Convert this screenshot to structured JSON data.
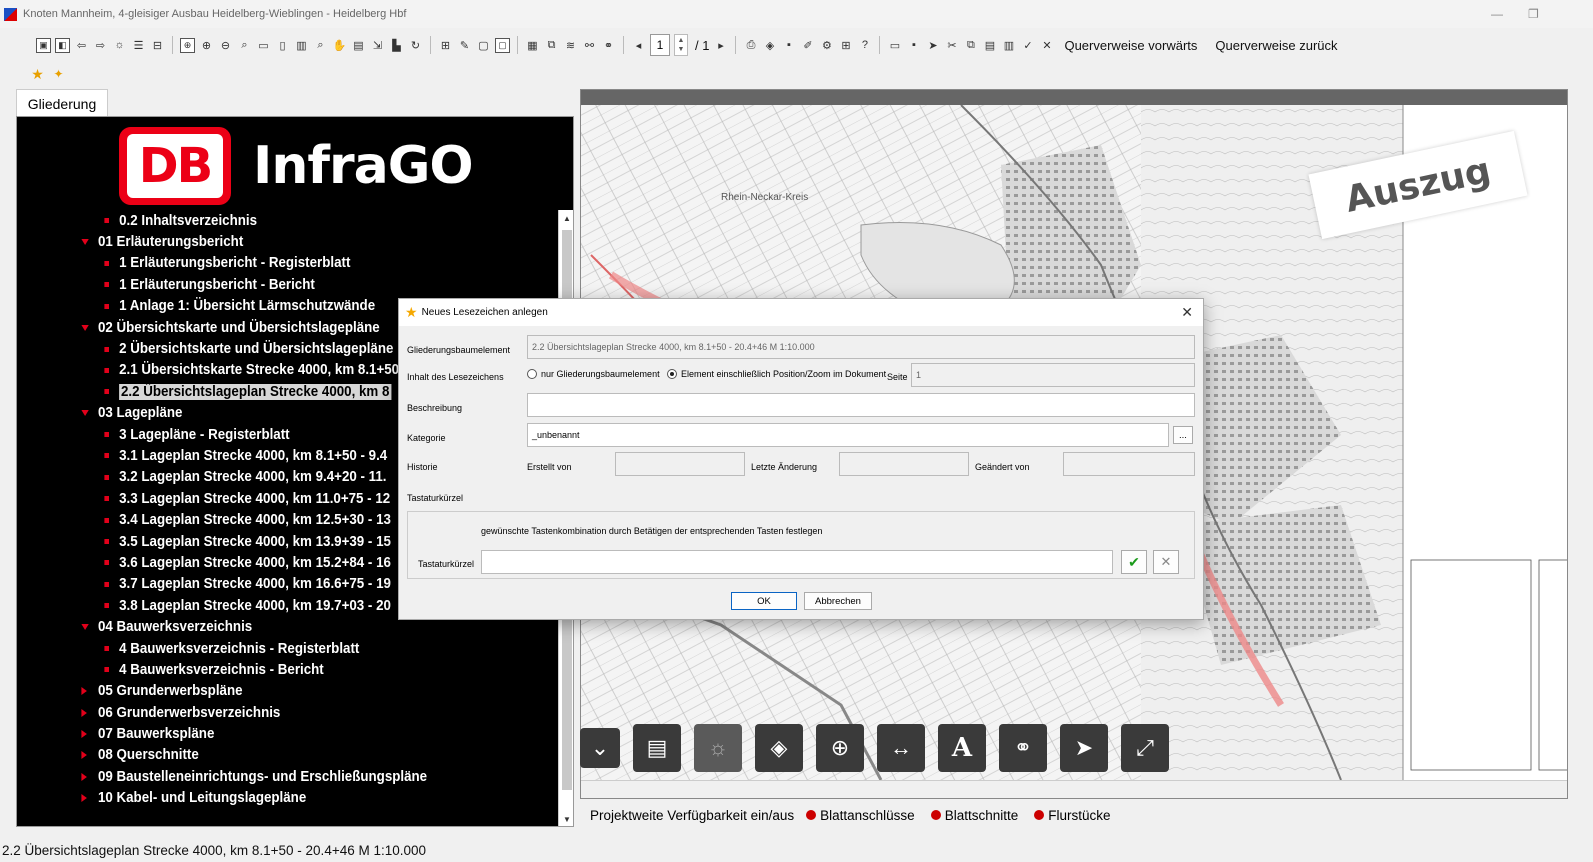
{
  "window": {
    "title": "Knoten Mannheim, 4-gleisiger Ausbau Heidelberg-Wieblingen - Heidelberg Hbf"
  },
  "toolbar": {
    "page_current": "1",
    "page_total": "/ 1",
    "cross_ref_forward": "Querverweise vorwärts",
    "cross_ref_back": "Querverweise zurück"
  },
  "left_panel": {
    "tab_label": "Gliederung",
    "logo_db": "DB",
    "logo_text": "InfraGO"
  },
  "tree": [
    {
      "label": "0.2 Inhaltsverzeichnis",
      "level": 1,
      "type": "leaf"
    },
    {
      "label": "01 Erläuterungsbericht",
      "level": 0,
      "type": "open"
    },
    {
      "label": "1 Erläuterungsbericht - Registerblatt",
      "level": 1,
      "type": "leaf"
    },
    {
      "label": "1 Erläuterungsbericht - Bericht",
      "level": 1,
      "type": "leaf"
    },
    {
      "label": "1 Anlage 1: Übersicht Lärmschutzwände",
      "level": 1,
      "type": "leaf"
    },
    {
      "label": "02 Übersichtskarte und Übersichtslagepläne",
      "level": 0,
      "type": "open"
    },
    {
      "label": "2 Übersichtskarte und Übersichtslagepläne",
      "level": 1,
      "type": "leaf"
    },
    {
      "label": "2.1 Übersichtskarte Strecke 4000, km 8.1+50",
      "level": 1,
      "type": "leaf"
    },
    {
      "label": "2.2 Übersichtslageplan Strecke 4000, km 8",
      "level": 1,
      "type": "leaf",
      "selected": true
    },
    {
      "label": "03 Lagepläne",
      "level": 0,
      "type": "open"
    },
    {
      "label": "3 Lagepläne - Registerblatt",
      "level": 1,
      "type": "leaf"
    },
    {
      "label": "3.1 Lageplan Strecke 4000, km 8.1+50 - 9.4",
      "level": 1,
      "type": "leaf"
    },
    {
      "label": "3.2 Lageplan Strecke 4000, km 9.4+20 - 11.",
      "level": 1,
      "type": "leaf"
    },
    {
      "label": "3.3 Lageplan Strecke 4000, km 11.0+75 - 12",
      "level": 1,
      "type": "leaf"
    },
    {
      "label": "3.4 Lageplan Strecke 4000, km 12.5+30 - 13",
      "level": 1,
      "type": "leaf"
    },
    {
      "label": "3.5 Lageplan Strecke 4000, km 13.9+39 - 15",
      "level": 1,
      "type": "leaf"
    },
    {
      "label": "3.6 Lageplan Strecke 4000, km 15.2+84 - 16",
      "level": 1,
      "type": "leaf"
    },
    {
      "label": "3.7 Lageplan Strecke 4000, km 16.6+75 - 19",
      "level": 1,
      "type": "leaf"
    },
    {
      "label": "3.8 Lageplan Strecke 4000, km 19.7+03 - 20",
      "level": 1,
      "type": "leaf"
    },
    {
      "label": "04 Bauwerksverzeichnis",
      "level": 0,
      "type": "open"
    },
    {
      "label": "4 Bauwerksverzeichnis - Registerblatt",
      "level": 1,
      "type": "leaf"
    },
    {
      "label": "4 Bauwerksverzeichnis - Bericht",
      "level": 1,
      "type": "leaf"
    },
    {
      "label": "05 Grunderwerbspläne",
      "level": 0,
      "type": "closed"
    },
    {
      "label": "06 Grunderwerbsverzeichnis",
      "level": 0,
      "type": "closed"
    },
    {
      "label": "07 Bauwerkspläne",
      "level": 0,
      "type": "closed"
    },
    {
      "label": "08 Querschnitte",
      "level": 0,
      "type": "closed"
    },
    {
      "label": "09 Baustelleneinrichtungs- und Erschließungspläne",
      "level": 0,
      "type": "closed"
    },
    {
      "label": "10 Kabel- und Leitungslagepläne",
      "level": 0,
      "type": "closed"
    }
  ],
  "map": {
    "label_kreis": "Rhein-Neckar-Kreis",
    "stamp": "Auszug"
  },
  "status": {
    "availability": "Projektweite Verfügbarkeit ein/aus",
    "layer1": "Blattanschlüsse",
    "layer2": "Blattschnitte",
    "layer3": "Flurstücke"
  },
  "bottom_text": "2.2 Übersichtslageplan Strecke 4000, km 8.1+50 - 20.4+46   M 1:10.000",
  "dialog": {
    "title": "Neues Lesezeichen anlegen",
    "element_label": "Gliederungsbaumelement",
    "element_value": "2.2 Übersichtslageplan Strecke 4000, km 8.1+50 - 20.4+46   M 1:10.000",
    "content_label": "Inhalt des Lesezeichens",
    "radio1": "nur Gliederungsbaumelement",
    "radio2": "Element einschließlich Position/Zoom im Dokument",
    "page_label": "Seite",
    "page_value": "1",
    "desc_label": "Beschreibung",
    "cat_label": "Kategorie",
    "cat_value": "_unbenannt",
    "cat_button": "...",
    "history_label": "Historie",
    "created_label": "Erstellt von",
    "changed_label": "Letzte Änderung",
    "modified_label": "Geändert von",
    "shortcut_section": "Tastaturkürzel",
    "shortcut_hint": "gewünschte Tastenkombination durch Betätigen der entsprechenden Tasten festlegen",
    "shortcut_label": "Tastaturkürzel",
    "ok": "OK",
    "cancel": "Abbrechen"
  }
}
